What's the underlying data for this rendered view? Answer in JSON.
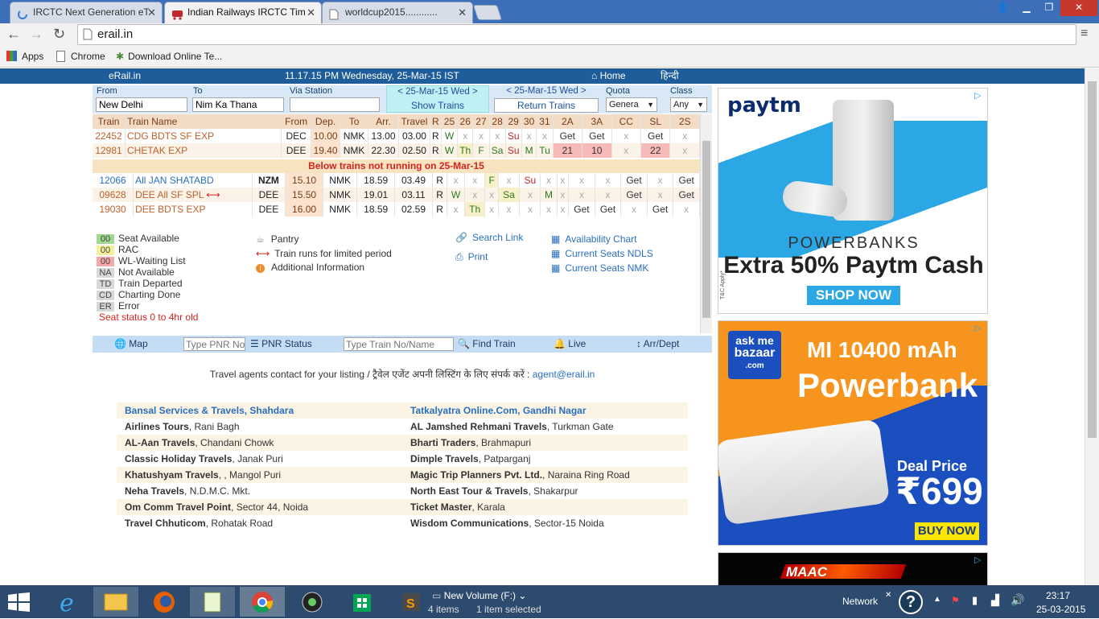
{
  "tabs": [
    {
      "title": "IRCTC Next Generation eT"
    },
    {
      "title": "Indian Railways IRCTC Tim"
    },
    {
      "title": "worldcup2015............"
    }
  ],
  "toolbar": {
    "url": "erail.in"
  },
  "bookmarks": [
    {
      "label": "Apps"
    },
    {
      "label": "Chrome"
    },
    {
      "label": "Download Online Te..."
    }
  ],
  "site": {
    "brand": "eRail.in",
    "datetime": "11.17.15 PM Wednesday, 25-Mar-15 IST",
    "home": "Home",
    "hindi": "हिन्दी"
  },
  "form": {
    "from_label": "From",
    "from_value": "New Delhi",
    "to_label": "To",
    "to_value": "Nim Ka Thana",
    "via_label": "Via Station",
    "via_value": "",
    "date_nav": "< 25-Mar-15 Wed >",
    "show_trains": "Show Trains",
    "return_date_nav": "< 25-Mar-15 Wed >",
    "return_trains": "Return Trains",
    "quota_label": "Quota",
    "quota_value": "Genera",
    "class_label": "Class",
    "class_value": "Any"
  },
  "table": {
    "headers": [
      "Train",
      "Train Name",
      "From",
      "Dep.",
      "To",
      "Arr.",
      "Travel",
      "R",
      "25",
      "26",
      "27",
      "28",
      "29",
      "30",
      "31",
      "2A",
      "3A",
      "CC",
      "SL",
      "2S"
    ],
    "running": [
      {
        "no": "22452",
        "name": "CDG BDTS SF EXP",
        "from": "DEC",
        "dep": "10.00",
        "to": "NMK",
        "arr": "13.00",
        "travel": "03.00",
        "r": "R",
        "days": [
          "W",
          "x",
          "x",
          "x",
          "Su",
          "x",
          "x"
        ],
        "classes": [
          "Get",
          "Get",
          "x",
          "Get",
          "x"
        ]
      },
      {
        "no": "12981",
        "name": "CHETAK EXP",
        "from": "DEE",
        "dep": "19.40",
        "to": "NMK",
        "arr": "22.30",
        "travel": "02.50",
        "r": "R",
        "days": [
          "W",
          "Th",
          "F",
          "Sa",
          "Su",
          "M",
          "Tu"
        ],
        "classes": [
          "21",
          "10",
          "x",
          "22",
          "x"
        ]
      }
    ],
    "not_running_label": "Below trains not running on 25-Mar-15",
    "not_running": [
      {
        "no": "12066",
        "name": "All JAN SHATABD",
        "from": "NZM",
        "dep": "15.10",
        "to": "NMK",
        "arr": "18.59",
        "travel": "03.49",
        "r": "R",
        "days": [
          "x",
          "x",
          "F",
          "x",
          "Su",
          "x",
          "x"
        ],
        "classes": [
          "x",
          "x",
          "Get",
          "x",
          "Get"
        ]
      },
      {
        "no": "09628",
        "name": "DEE All SF SPL",
        "from": "DEE",
        "dep": "15.50",
        "to": "NMK",
        "arr": "19.01",
        "travel": "03.11",
        "r": "R",
        "days": [
          "W",
          "x",
          "x",
          "Sa",
          "x",
          "M",
          "x"
        ],
        "classes": [
          "x",
          "x",
          "Get",
          "x",
          "Get"
        ]
      },
      {
        "no": "19030",
        "name": "DEE BDTS EXP",
        "from": "DEE",
        "dep": "16.00",
        "to": "NMK",
        "arr": "18.59",
        "travel": "02.59",
        "r": "R",
        "days": [
          "x",
          "Th",
          "x",
          "x",
          "x",
          "x",
          "x"
        ],
        "classes": [
          "Get",
          "Get",
          "x",
          "Get",
          "x"
        ]
      }
    ]
  },
  "legend": {
    "items": [
      {
        "code": "00",
        "label": "Seat Available",
        "color": "#9fd88f"
      },
      {
        "code": "00",
        "label": "RAC",
        "color": "#f6ee9a"
      },
      {
        "code": "00",
        "label": "WL-Waiting List",
        "color": "#f4a8a8"
      },
      {
        "code": "NA",
        "label": "Not Available",
        "color": "#d8d8d8"
      },
      {
        "code": "TD",
        "label": "Train Departed",
        "color": "#d8d8d8"
      },
      {
        "code": "CD",
        "label": "Charting Done",
        "color": "#d8d8d8"
      },
      {
        "code": "ER",
        "label": "Error",
        "color": "#d8d8d8"
      }
    ],
    "seat_status": "Seat status 0 to 4hr old",
    "pantry": "Pantry",
    "limited": "Train runs for limited period",
    "additional": "Additional Information",
    "search_link": "Search Link",
    "print": "Print",
    "availability_chart": "Availability Chart",
    "current_seats_ndls": "Current Seats NDLS",
    "current_seats_nmk": "Current Seats NMK"
  },
  "toolbar2": {
    "map": "Map",
    "pnr_placeholder": "Type PNR No",
    "pnr_status": "PNR Status",
    "train_placeholder": "Type Train No/Name",
    "find_train": "Find Train",
    "live": "Live",
    "arr_dept": "Arr/Dept"
  },
  "agents": {
    "intro": "Travel agents contact for your listing / ट्रैवेल एजेंट अपनी लिस्टिंग के लिए संपर्क करें :",
    "email": "agent@erail.in",
    "list": [
      {
        "name": "Bansal Services & Travels, Shahdara",
        "loc": "",
        "featured": true
      },
      {
        "name": "Tatkalyatra Online.Com, Gandhi Nagar",
        "loc": "",
        "featured": true
      },
      {
        "name": "Airlines Tours",
        "loc": ", Rani Bagh"
      },
      {
        "name": "AL Jamshed Rehmani Travels",
        "loc": ", Turkman Gate"
      },
      {
        "name": "AL-Aan Travels",
        "loc": ", Chandani Chowk"
      },
      {
        "name": "Bharti Traders",
        "loc": ", Brahmapuri"
      },
      {
        "name": "Classic Holiday Travels",
        "loc": ", Janak Puri"
      },
      {
        "name": "Dimple Travels",
        "loc": ", Patparganj"
      },
      {
        "name": "Khatushyam Travels",
        "loc": ", , Mangol Puri"
      },
      {
        "name": "Magic Trip Planners Pvt. Ltd.",
        "loc": ", Naraina Ring Road"
      },
      {
        "name": "Neha Travels",
        "loc": ", N.D.M.C. Mkt."
      },
      {
        "name": "North East Tour & Travels",
        "loc": ", Shakarpur"
      },
      {
        "name": "Om Comm Travel Point",
        "loc": ", Sector 44, Noida"
      },
      {
        "name": "Ticket Master",
        "loc": ", Karala"
      },
      {
        "name": "Travel Chhuticom",
        "loc": ", Rohatak Road"
      },
      {
        "name": "Wisdom Communications",
        "loc": ", Sector-15 Noida"
      }
    ]
  },
  "ads": {
    "paytm": {
      "brand": "paytm",
      "line1": "POWERBANKS",
      "line2": "Extra 50% Paytm Cash",
      "cta": "SHOP NOW",
      "fine": "T&C Apply*"
    },
    "askme": {
      "brand_top": "ask me",
      "brand_mid": "bazaar",
      "brand_bot": ".com",
      "line1": "MI 10400 mAh",
      "line2": "Powerbank",
      "deal": "Deal Price",
      "price": "₹699",
      "cta": "BUY NOW"
    },
    "maac": {
      "brand": "MAAC"
    }
  },
  "taskbar": {
    "explorer_title": "New Volume (F:)",
    "items_count": "4 items",
    "selected": "1 item selected",
    "network": "Network",
    "time": "23:17",
    "date": "25-03-2015"
  }
}
